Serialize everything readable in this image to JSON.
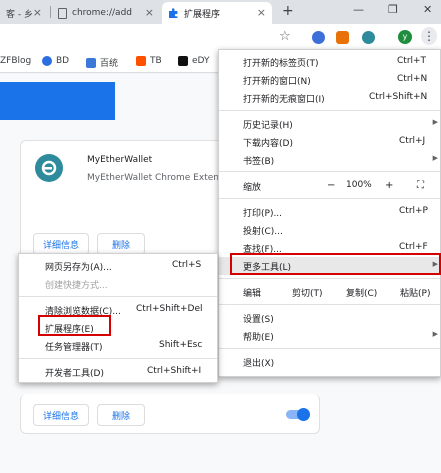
{
  "tabs": [
    {
      "label": "客 - 乡",
      "close": "×"
    },
    {
      "label": "chrome://add",
      "close": "×"
    },
    {
      "label": "扩展程序",
      "close": "×"
    }
  ],
  "new_tab": "+",
  "window_controls": {
    "minimize": "—",
    "restore": "❐",
    "close": "✕"
  },
  "toolbar": {
    "star": "☆",
    "avatar_letter": "y",
    "menu": "⋮"
  },
  "bookmarks": [
    {
      "label": "ZFBlog"
    },
    {
      "label": "BD"
    },
    {
      "label": "百统"
    },
    {
      "label": "TB"
    },
    {
      "label": "eDY"
    }
  ],
  "extension_card": {
    "name": "MyEtherWallet",
    "description": "MyEtherWallet Chrome Exten",
    "details_button": "详细信息",
    "remove_button": "删除"
  },
  "bottom_card": {
    "details_button": "详细信息",
    "remove_button": "删除",
    "enabled": true
  },
  "main_menu": {
    "items": [
      {
        "label": "打开新的标签页(T)",
        "shortcut": "Ctrl+T"
      },
      {
        "label": "打开新的窗口(N)",
        "shortcut": "Ctrl+N"
      },
      {
        "label": "打开新的无痕窗口(I)",
        "shortcut": "Ctrl+Shift+N"
      },
      {
        "label": "历史记录(H)"
      },
      {
        "label": "下载内容(D)",
        "shortcut": "Ctrl+J"
      },
      {
        "label": "书签(B)"
      },
      {
        "label": "缩放"
      },
      {
        "label": "打印(P)...",
        "shortcut": "Ctrl+P"
      },
      {
        "label": "投射(C)..."
      },
      {
        "label": "查找(F)...",
        "shortcut": "Ctrl+F"
      },
      {
        "label": "更多工具(L)"
      },
      {
        "label": "编辑"
      },
      {
        "label": "设置(S)"
      },
      {
        "label": "帮助(E)"
      },
      {
        "label": "退出(X)"
      }
    ],
    "zoom": {
      "minus": "−",
      "value": "100%",
      "plus": "+",
      "fullscreen": "⛶"
    },
    "edit": {
      "cut": "剪切(T)",
      "copy": "复制(C)",
      "paste": "粘贴(P)"
    }
  },
  "submenu": {
    "items": [
      {
        "label": "网页另存为(A)...",
        "shortcut": "Ctrl+S"
      },
      {
        "label": "创建快捷方式..."
      },
      {
        "label": "清除浏览数据(C)...",
        "shortcut": "Ctrl+Shift+Del"
      },
      {
        "label": "扩展程序(E)"
      },
      {
        "label": "任务管理器(T)",
        "shortcut": "Shift+Esc"
      },
      {
        "label": "开发者工具(D)",
        "shortcut": "Ctrl+Shift+I"
      }
    ]
  },
  "colors": {
    "accent": "#1a73e8",
    "highlight": "#d50000"
  }
}
